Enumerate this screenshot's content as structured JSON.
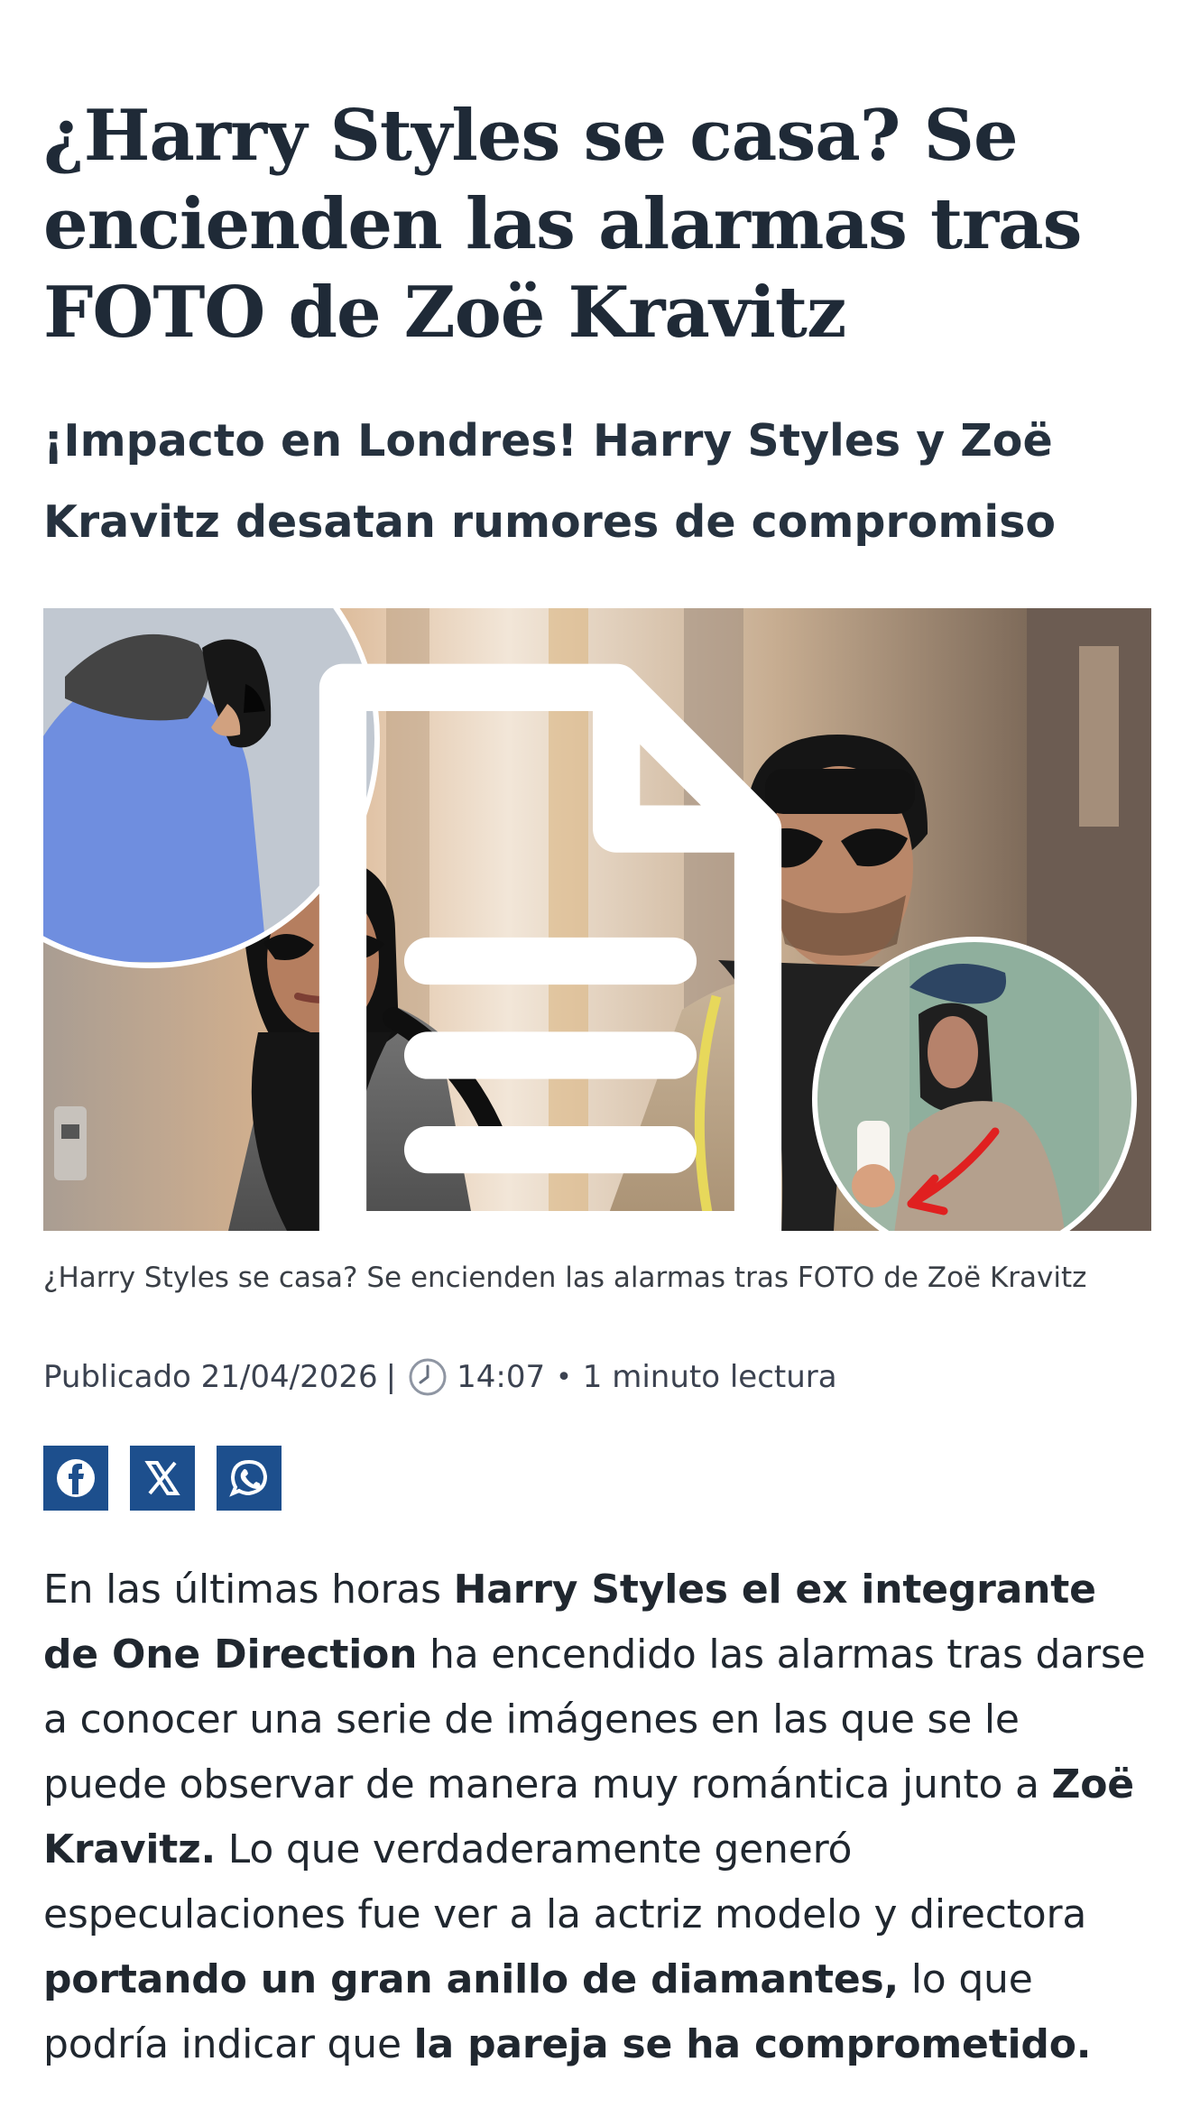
{
  "article": {
    "headline": "¿Harry Styles se casa? Se encienden las alarmas tras FOTO de Zoë Kravitz",
    "subtitle": "¡Impacto en Londres! Harry Styles y Zoë Kravitz desatan rumores de compromiso",
    "caption": "¿Harry Styles se casa? Se encienden las alarmas tras FOTO de Zoë Kravitz",
    "meta": {
      "published_label": "Publicado",
      "date": "21/04/2026",
      "separator": "|",
      "time": "14:07",
      "dot": "•",
      "reading_time": "1 minuto lectura"
    },
    "share": {
      "facebook_icon": "facebook-icon",
      "x_icon": "x-icon",
      "whatsapp_icon": "whatsapp-icon"
    },
    "body": {
      "p1_a": "En las últimas horas ",
      "p1_b": "Harry Styles el ex integrante de One Direction",
      "p1_c": " ha encendido las alarmas tras darse a conocer una serie de imágenes en las que se le puede observar de manera muy romántica junto a ",
      "p1_d": "Zoë Kravitz.",
      "p1_e": " Lo que verdaderamente generó especulaciones fue ver a la actriz modelo y directora ",
      "p1_f": "portando un gran anillo de diamantes,",
      "p1_g": " lo que podría indicar que ",
      "p1_h": "la pareja se ha comprometido."
    }
  },
  "colors": {
    "headline": "#1f2a37",
    "share_button": "#1d4f8d",
    "body_text": "#20272f",
    "caption": "#3a3f46"
  }
}
